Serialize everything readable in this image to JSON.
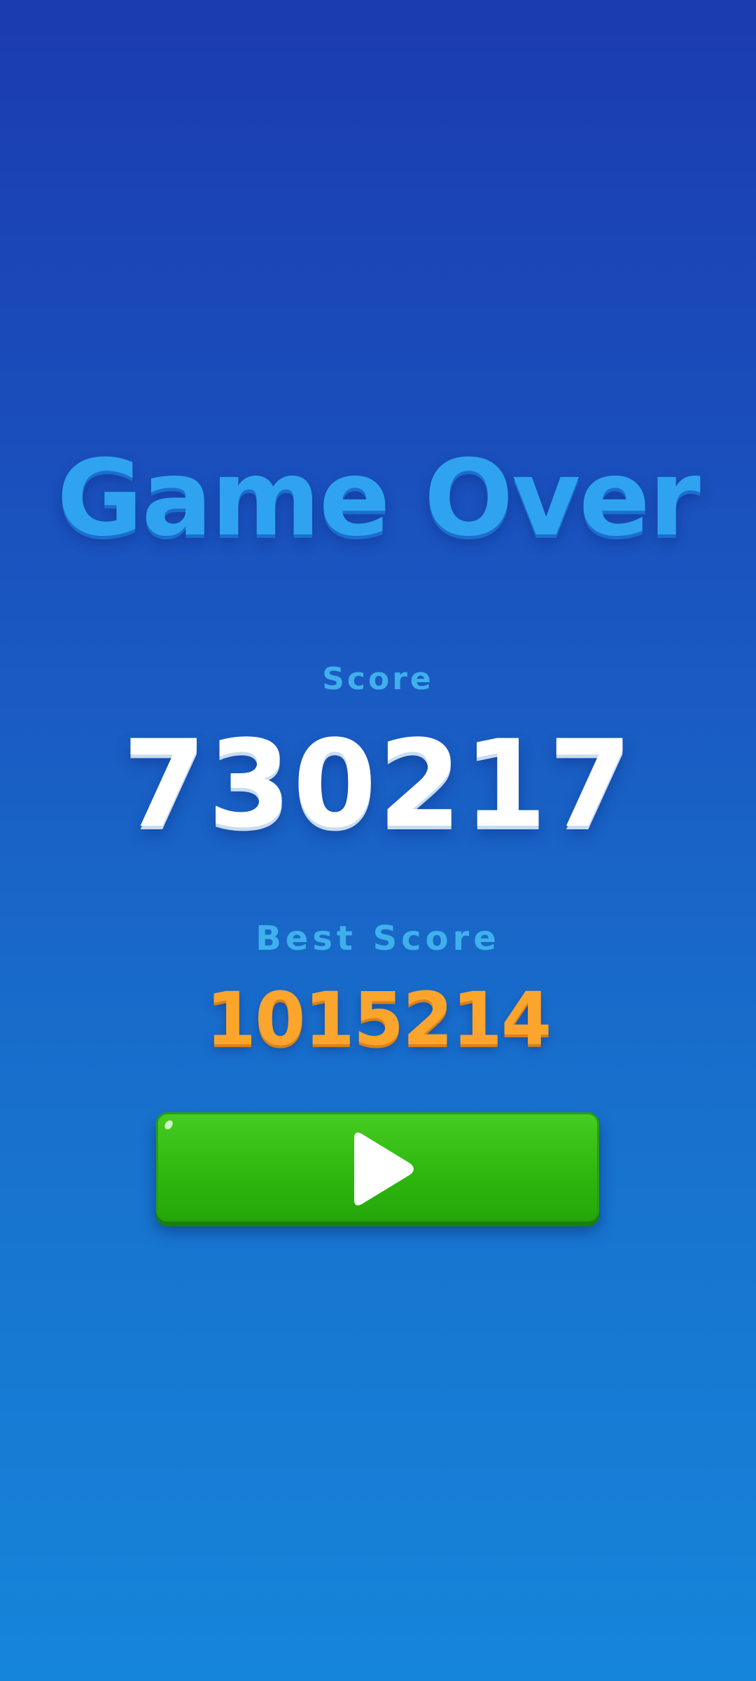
{
  "game_over": {
    "title": "Game Over",
    "score_label": "Score",
    "score_value": "730217",
    "best_score_label": "Best Score",
    "best_score_value": "1015214",
    "play_button": {
      "icon": "play-icon",
      "color": "#2fb80f"
    }
  },
  "colors": {
    "title": "#2fa3f0",
    "labels": "#3fb0ec",
    "score": "#ffffff",
    "best_score": "#fba52d",
    "background_top": "#1b3bb0",
    "background_bottom": "#1585da"
  }
}
